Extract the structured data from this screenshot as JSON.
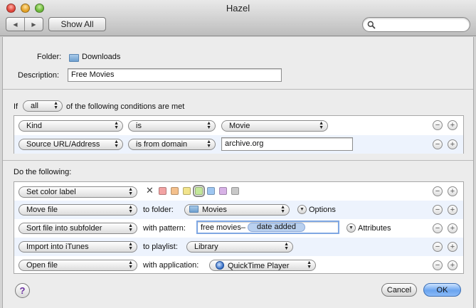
{
  "window": {
    "title": "Hazel"
  },
  "toolbar": {
    "back_icon": "back-arrow-icon",
    "forward_icon": "forward-arrow-icon",
    "show_all": "Show All",
    "search_placeholder": ""
  },
  "folder": {
    "label": "Folder:",
    "name": "Downloads"
  },
  "description": {
    "label": "Description:",
    "value": "Free Movies"
  },
  "conditions": {
    "prefix": "If",
    "match": "all",
    "suffix": "of the following conditions are met",
    "rows": [
      {
        "attribute": "Kind",
        "operator": "is",
        "value": "Movie"
      },
      {
        "attribute": "Source URL/Address",
        "operator": "is from domain",
        "value": "archive.org"
      }
    ]
  },
  "actions": {
    "header": "Do the following:",
    "rows": [
      {
        "action": "Set color label",
        "colors": [
          "#f2a3a3",
          "#f4c08c",
          "#f2e48c",
          "#c4e89a",
          "#9ec6f1",
          "#d7b2e6",
          "#c8c8c8"
        ],
        "selected_color": 3
      },
      {
        "action": "Move file",
        "target_label": "to folder:",
        "target": "Movies",
        "options_label": "Options"
      },
      {
        "action": "Sort file into subfolder",
        "target_label": "with pattern:",
        "pattern_text": "free movies–",
        "pattern_token": "date added",
        "options_label": "Attributes"
      },
      {
        "action": "Import into iTunes",
        "target_label": "to playlist:",
        "target": "Library"
      },
      {
        "action": "Open file",
        "target_label": "with application:",
        "target": "QuickTime Player"
      }
    ]
  },
  "buttons": {
    "help": "?",
    "cancel": "Cancel",
    "ok": "OK"
  },
  "controls": {
    "remove": "−",
    "add": "+",
    "clear_color": "✕"
  }
}
